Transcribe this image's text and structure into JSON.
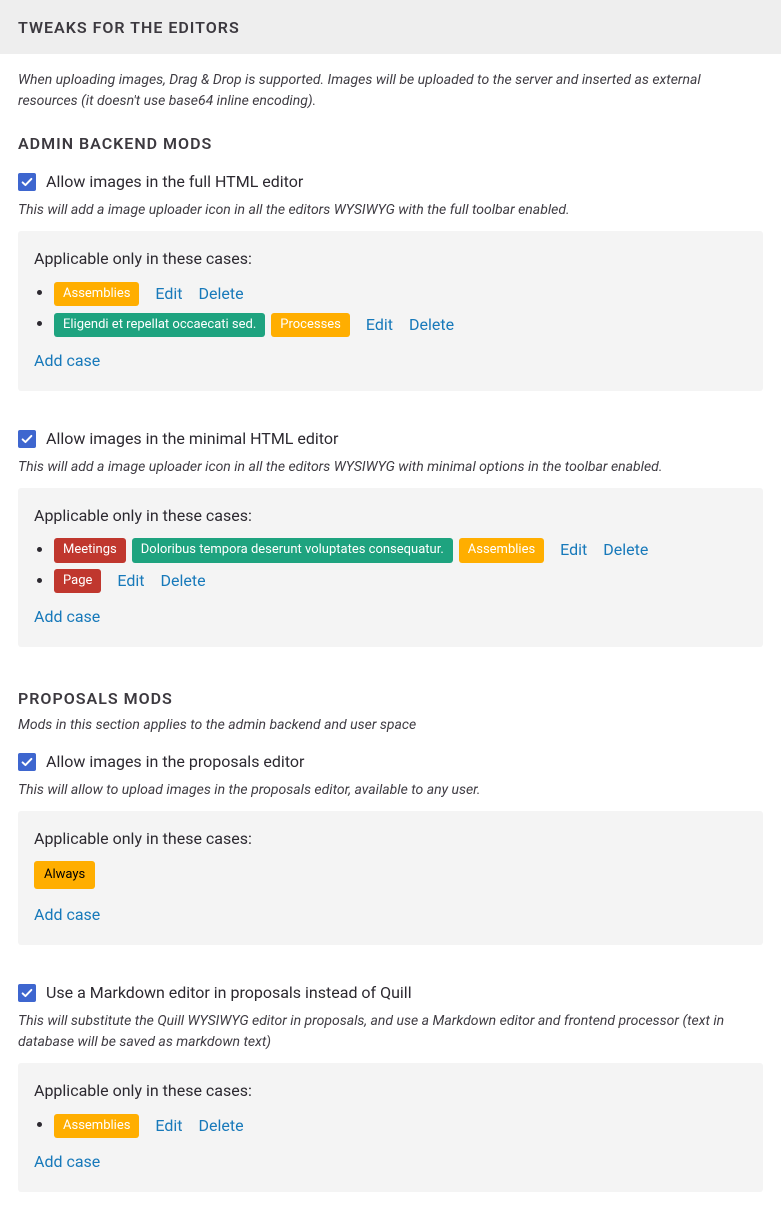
{
  "header": {
    "title": "TWEAKS FOR THE EDITORS"
  },
  "intro": "When uploading images, Drag & Drop is supported. Images will be uploaded to the server and inserted as external resources (it doesn't use base64 inline encoding).",
  "labels": {
    "applicable": "Applicable only in these cases:",
    "edit": "Edit",
    "delete": "Delete",
    "add_case": "Add case",
    "always": "Always"
  },
  "sections": {
    "admin": {
      "title": "ADMIN BACKEND MODS",
      "settings": {
        "full_editor": {
          "label": "Allow images in the full HTML editor",
          "help": "This will add a image uploader icon in all the editors WYSIWYG with the full toolbar enabled.",
          "cases": [
            {
              "tags": [
                {
                  "text": "Assemblies",
                  "color": "yellow"
                }
              ]
            },
            {
              "tags": [
                {
                  "text": "Eligendi et repellat occaecati sed.",
                  "color": "green"
                },
                {
                  "text": "Processes",
                  "color": "yellow"
                }
              ]
            }
          ]
        },
        "minimal_editor": {
          "label": "Allow images in the minimal HTML editor",
          "help": "This will add a image uploader icon in all the editors WYSIWYG with minimal options in the toolbar enabled.",
          "cases": [
            {
              "tags": [
                {
                  "text": "Meetings",
                  "color": "red"
                },
                {
                  "text": "Doloribus tempora deserunt voluptates consequatur.",
                  "color": "green"
                },
                {
                  "text": "Assemblies",
                  "color": "yellow"
                }
              ]
            },
            {
              "tags": [
                {
                  "text": "Page",
                  "color": "red"
                }
              ]
            }
          ]
        }
      }
    },
    "proposals": {
      "title": "PROPOSALS MODS",
      "desc": "Mods in this section applies to the admin backend and user space",
      "settings": {
        "images": {
          "label": "Allow images in the proposals editor",
          "help": "This will allow to upload images in the proposals editor, available to any user."
        },
        "markdown": {
          "label": "Use a Markdown editor in proposals instead of Quill",
          "help": "This will substitute the Quill WYSIWYG editor in proposals, and use a Markdown editor and frontend processor (text in database will be saved as markdown text)",
          "cases": [
            {
              "tags": [
                {
                  "text": "Assemblies",
                  "color": "yellow"
                }
              ]
            }
          ]
        }
      }
    }
  }
}
